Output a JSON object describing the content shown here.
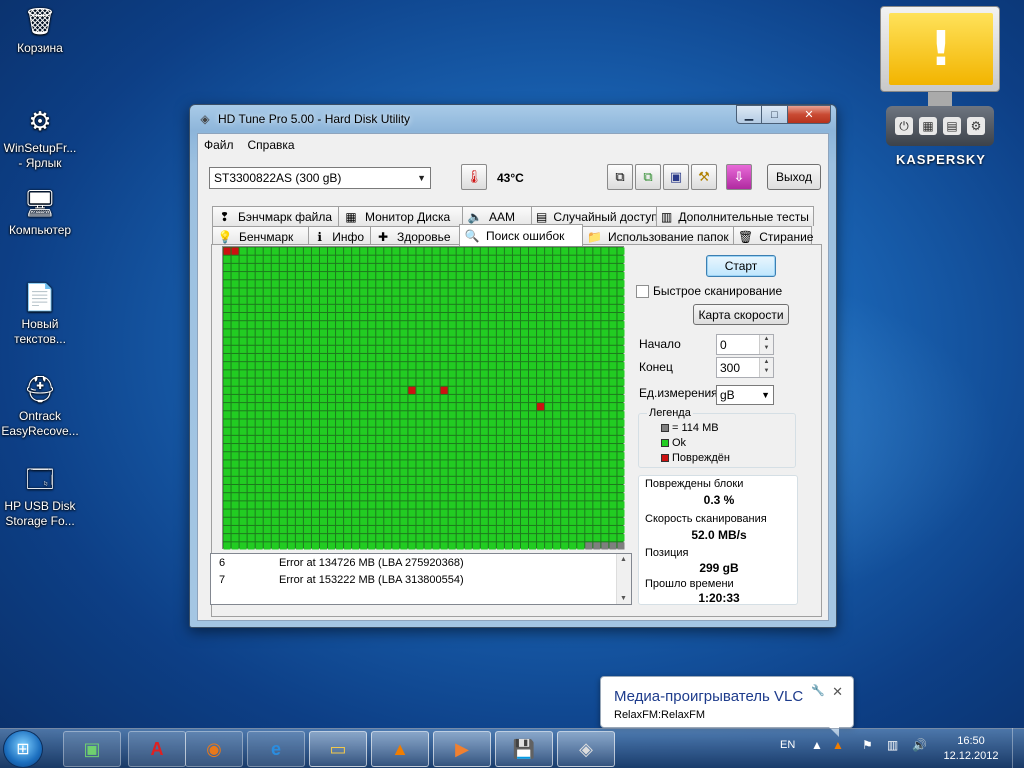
{
  "desktop": {
    "icons": [
      {
        "name": "recycle-bin",
        "label": "Корзина",
        "glyph": "🗑"
      },
      {
        "name": "winsetup",
        "label": "WinSetupFr...\n- Ярлык",
        "glyph": "⚙"
      },
      {
        "name": "computer",
        "label": "Компьютер",
        "glyph": "🖥"
      },
      {
        "name": "new-text",
        "label": "Новый\nтекстов...",
        "glyph": "📄"
      },
      {
        "name": "ontrack",
        "label": "Ontrack\nEasyRecove...",
        "glyph": "⛑"
      },
      {
        "name": "hp-usb",
        "label": "HP USB Disk\nStorage Fo...",
        "glyph": "🗔"
      }
    ]
  },
  "kaspersky": {
    "brand": "KASPERSKY",
    "alert": "!"
  },
  "window": {
    "title": "HD Tune Pro 5.00 - Hard Disk Utility",
    "menu": {
      "file": "Файл",
      "help": "Справка"
    },
    "drive": "ST3300822AS (300 gB)",
    "temperature": "43°C",
    "exit_label": "Выход",
    "tabs_top": [
      {
        "label": "Бэнчмарк файла",
        "icon": "file-benchmark-icon",
        "glyph": "❢"
      },
      {
        "label": "Монитор Диска",
        "icon": "disk-monitor-icon",
        "glyph": "▦"
      },
      {
        "label": "AAM",
        "icon": "speaker-icon",
        "glyph": "🔈"
      },
      {
        "label": "Случайный доступ",
        "icon": "random-access-icon",
        "glyph": "▤"
      },
      {
        "label": "Дополнительные  тесты",
        "icon": "extra-tests-icon",
        "glyph": "▥"
      }
    ],
    "tabs_bottom": [
      {
        "label": "Бенчмарк",
        "icon": "bulb-icon",
        "glyph": "💡"
      },
      {
        "label": "Инфо",
        "icon": "info-icon",
        "glyph": "ℹ"
      },
      {
        "label": "Здоровье",
        "icon": "health-cross-icon",
        "glyph": "✚"
      },
      {
        "label": "Поиск ошибок",
        "icon": "magnifier-icon",
        "glyph": "🔍",
        "active": true
      },
      {
        "label": "Использование папок",
        "icon": "folder-icon",
        "glyph": "📁"
      },
      {
        "label": "Стирание",
        "icon": "trash-icon",
        "glyph": "🗑"
      }
    ],
    "error_scan": {
      "start_label": "Старт",
      "quick_scan_label": "Быстрое сканирование",
      "speed_map_label": "Карта скорости",
      "start_field_label": "Начало",
      "start_value": "0",
      "end_field_label": "Конец",
      "end_value": "300",
      "unit_label": "Ед.измерения",
      "unit_value": "gB",
      "legend_title": "Легенда",
      "legend": [
        {
          "label": "= 114 MB",
          "color": "#7f7f7f"
        },
        {
          "label": "Ok",
          "color": "#22cc22"
        },
        {
          "label": "Повреждён",
          "color": "#cc1111"
        }
      ],
      "damaged_blocks_label": "Повреждены блоки",
      "damaged_blocks_value": "0.3 %",
      "scan_speed_label": "Скорость сканирования",
      "scan_speed_value": "52.0 MB/s",
      "position_label": "Позиция",
      "position_value": "299 gB",
      "elapsed_label": "Прошло времени",
      "elapsed_value": "1:20:33",
      "log": [
        {
          "index": "6",
          "text": "Error at 134726 MB (LBA 275920368)"
        },
        {
          "index": "7",
          "text": "Error at 153222 MB (LBA 313800554)"
        }
      ],
      "grid": {
        "cols": 50,
        "rows": 37,
        "ok_color": "#22cc22",
        "damaged_color": "#cc1111",
        "unscanned_color": "#7f7f7f",
        "damaged_cells": [
          [
            0,
            0
          ],
          [
            0,
            1
          ],
          [
            17,
            23
          ],
          [
            17,
            27
          ],
          [
            19,
            39
          ]
        ],
        "unscanned_tail_count": 5
      }
    }
  },
  "vlc_popup": {
    "title": "Медиа-проигрыватель VLC",
    "body": "RelaxFM:RelaxFM"
  },
  "taskbar": {
    "lang": "EN",
    "time": "16:50",
    "date": "12.12.2012",
    "apps": [
      {
        "name": "taskbar-app-1",
        "glyph": "▣",
        "color": "#6fd06f"
      },
      {
        "name": "taskbar-acrobat",
        "glyph": "A",
        "color": "#e02020"
      },
      {
        "name": "taskbar-firefox",
        "glyph": "◉",
        "color": "#e8781a"
      },
      {
        "name": "taskbar-ie",
        "glyph": "e",
        "color": "#2a8de0"
      },
      {
        "name": "taskbar-explorer",
        "glyph": "▭",
        "color": "#f2c94c"
      },
      {
        "name": "taskbar-vlc",
        "glyph": "▲",
        "color": "#f07d00"
      },
      {
        "name": "taskbar-media",
        "glyph": "▶",
        "color": "#f08030"
      },
      {
        "name": "taskbar-floppy",
        "glyph": "💾",
        "color": "#6a5acd"
      },
      {
        "name": "taskbar-hdtune",
        "glyph": "◈",
        "color": "#dddddd"
      }
    ]
  }
}
